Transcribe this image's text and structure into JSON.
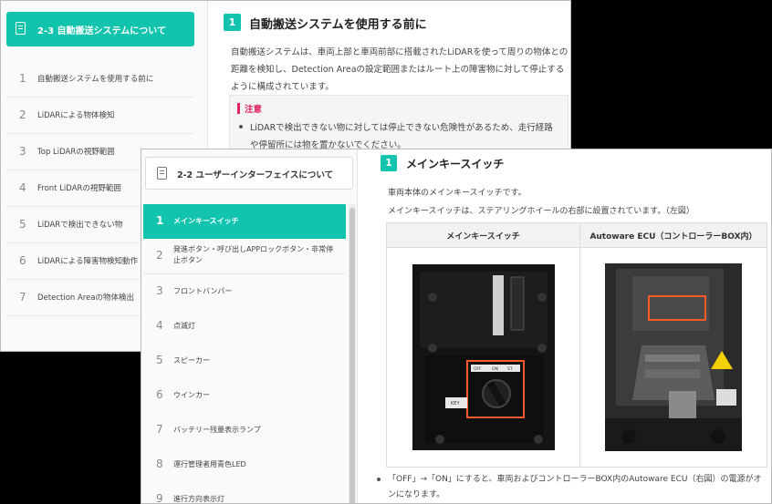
{
  "back": {
    "sidebar": {
      "header": "2-3 自動搬送システムについて",
      "items": [
        {
          "num": "1",
          "label": "自動搬送システムを使用する前に"
        },
        {
          "num": "2",
          "label": "LiDARによる物体検知"
        },
        {
          "num": "3",
          "label": "Top LiDARの視野範囲"
        },
        {
          "num": "4",
          "label": "Front LiDARの視野範囲"
        },
        {
          "num": "5",
          "label": "LiDARで検出できない物"
        },
        {
          "num": "6",
          "label": "LiDARによる障害物検知動作"
        },
        {
          "num": "7",
          "label": "Detection Areaの物体検出"
        }
      ]
    },
    "main": {
      "badge": "1",
      "title": "自動搬送システムを使用する前に",
      "paragraph": "自動搬送システムは、車両上部と車両前部に搭載されたLiDARを使って周りの物体との距離を検知し、Detection Areaの設定範囲またはルート上の障害物に対して停止するように構成されています。",
      "note_title": "注意",
      "note_text": "LiDARで検出できない物に対しては停止できない危険性があるため、走行経路や停留所には物を置かないでください。"
    }
  },
  "front": {
    "sidebar": {
      "header": "2-2 ユーザーインターフェイスについて",
      "items": [
        {
          "num": "1",
          "label": "メインキースイッチ"
        },
        {
          "num": "2",
          "label": "発進ボタン・呼び出しAPPロックボタン・非常停止ボタン"
        },
        {
          "num": "3",
          "label": "フロントバンパー"
        },
        {
          "num": "4",
          "label": "点滅灯"
        },
        {
          "num": "5",
          "label": "スピーカー"
        },
        {
          "num": "6",
          "label": "ウインカー"
        },
        {
          "num": "7",
          "label": "バッテリー残量表示ランプ"
        },
        {
          "num": "8",
          "label": "運行管理者用青色LED"
        },
        {
          "num": "9",
          "label": "進行方向表示灯"
        }
      ]
    },
    "main": {
      "badge": "1",
      "title": "メインキースイッチ",
      "line1": "車両本体のメインキースイッチです。",
      "line2": "メインキースイッチは、ステアリングホイールの右部に設置されています。（左図）",
      "table_headers": [
        "メインキースイッチ",
        "Autoware ECU（コントローラーBOX内）"
      ],
      "switch_labels": {
        "off": "OFF",
        "on": "ON",
        "start": "ST",
        "key": "KEY"
      },
      "bullet": "「OFF」→「ON」にすると、車両およびコントローラーBOX内のAutoware ECU（右図）の電源がオンになります。"
    }
  },
  "colors": {
    "accent": "#12c3ad",
    "caution": "#e0245e",
    "highlight_box": "#ff5a2a"
  }
}
